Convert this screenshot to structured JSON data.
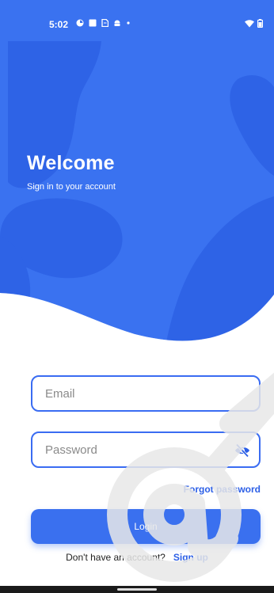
{
  "status_bar": {
    "time": "5:02",
    "left_icons": [
      "data-saver-icon",
      "square-notification-icon",
      "document-icon",
      "android-icon",
      "dot-icon"
    ],
    "right_icons": [
      "wifi-icon",
      "battery-icon"
    ]
  },
  "hero": {
    "title": "Welcome",
    "subtitle": "Sign in to your account",
    "primary_color": "#3a72f0",
    "blob_color": "#2e63e6"
  },
  "form": {
    "email_placeholder": "Email",
    "password_placeholder": "Password",
    "visibility_icon": "eye-off-icon",
    "forgot_label": "Forgot password",
    "login_label": "Login",
    "signup_prompt": "Don't have an account?",
    "signup_label": "Sign up",
    "accent_color": "#2c5fe6"
  }
}
